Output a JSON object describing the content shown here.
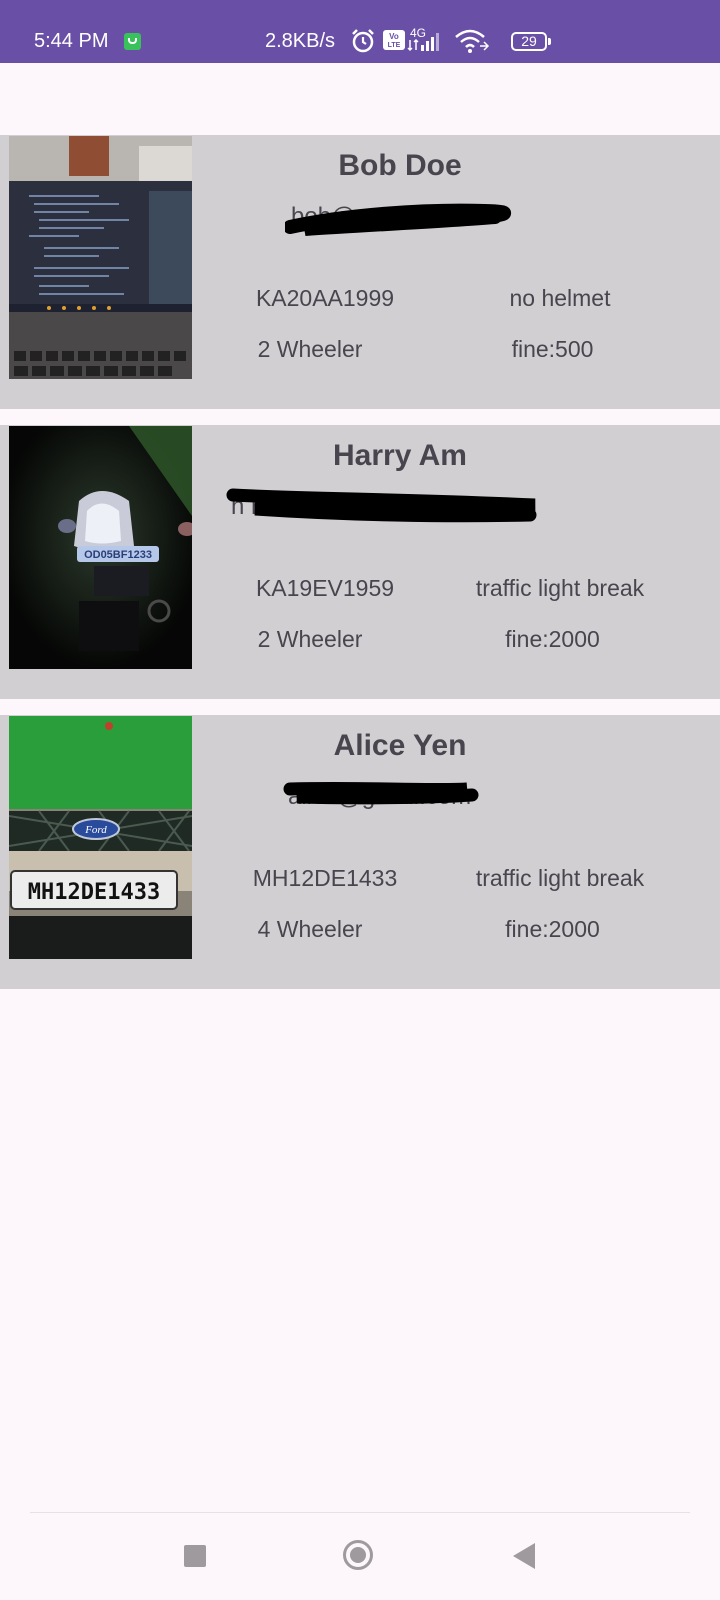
{
  "status_bar": {
    "time": "5:44 PM",
    "net_speed": "2.8KB/s",
    "network": "4G",
    "battery": "29"
  },
  "records": [
    {
      "name": "Bob Doe",
      "email": "bob@",
      "plate": "KA20AA1999",
      "violation": "no helmet",
      "vehicle_type": "2 Wheeler",
      "fine": "fine:500"
    },
    {
      "name": "Harry Am",
      "email": "h         rnowl1    @",
      "plate": "KA19EV1959",
      "violation": "traffic light break",
      "vehicle_type": "2 Wheeler",
      "fine": "fine:2000",
      "photo_plate_text": "OD05BF1233"
    },
    {
      "name": "Alice Yen",
      "email": "alice@gmail.com",
      "plate": "MH12DE1433",
      "violation": "traffic light break",
      "vehicle_type": "4 Wheeler",
      "fine": "fine:2000",
      "photo_plate_text": "MH12DE1433",
      "photo_badge_text": "Ford"
    }
  ]
}
